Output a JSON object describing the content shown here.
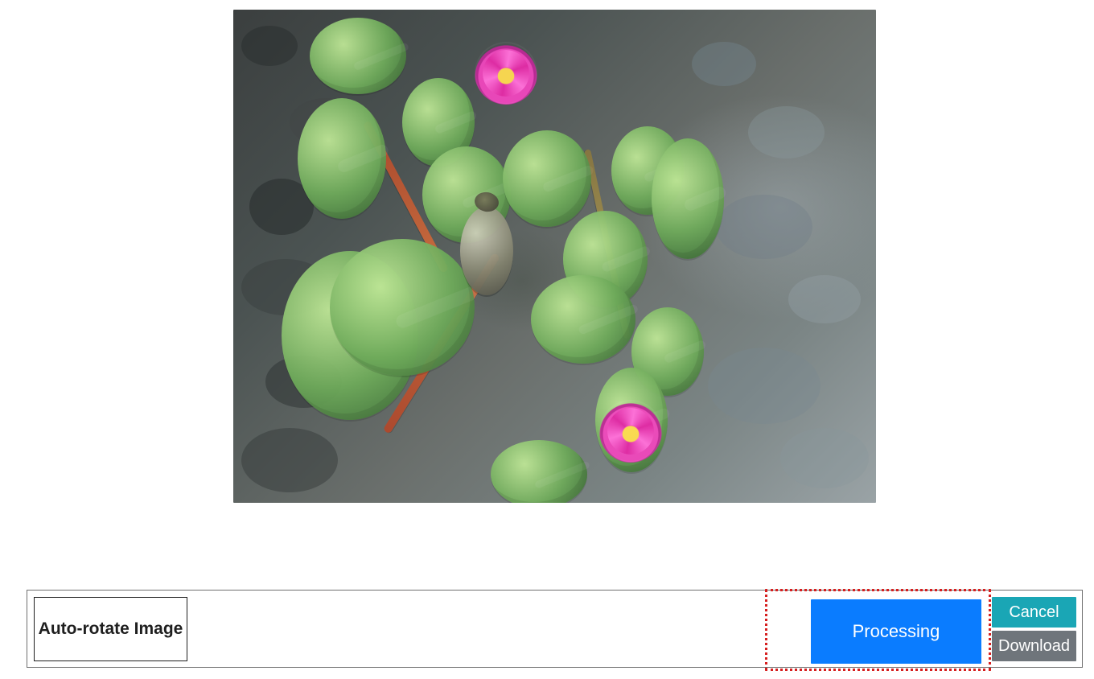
{
  "preview": {
    "alt": "Pond with lily pads, pink water lilies, and a turtle over pebbles"
  },
  "toolbar": {
    "auto_rotate_label": "Auto-rotate Image",
    "processing_label": "Processing",
    "cancel_label": "Cancel",
    "download_label": "Download"
  },
  "colors": {
    "processing_blue": "#0a7cff",
    "cancel_teal": "#1aa6b5",
    "download_gray": "#6f757b",
    "focus_red": "#d61f1f"
  }
}
